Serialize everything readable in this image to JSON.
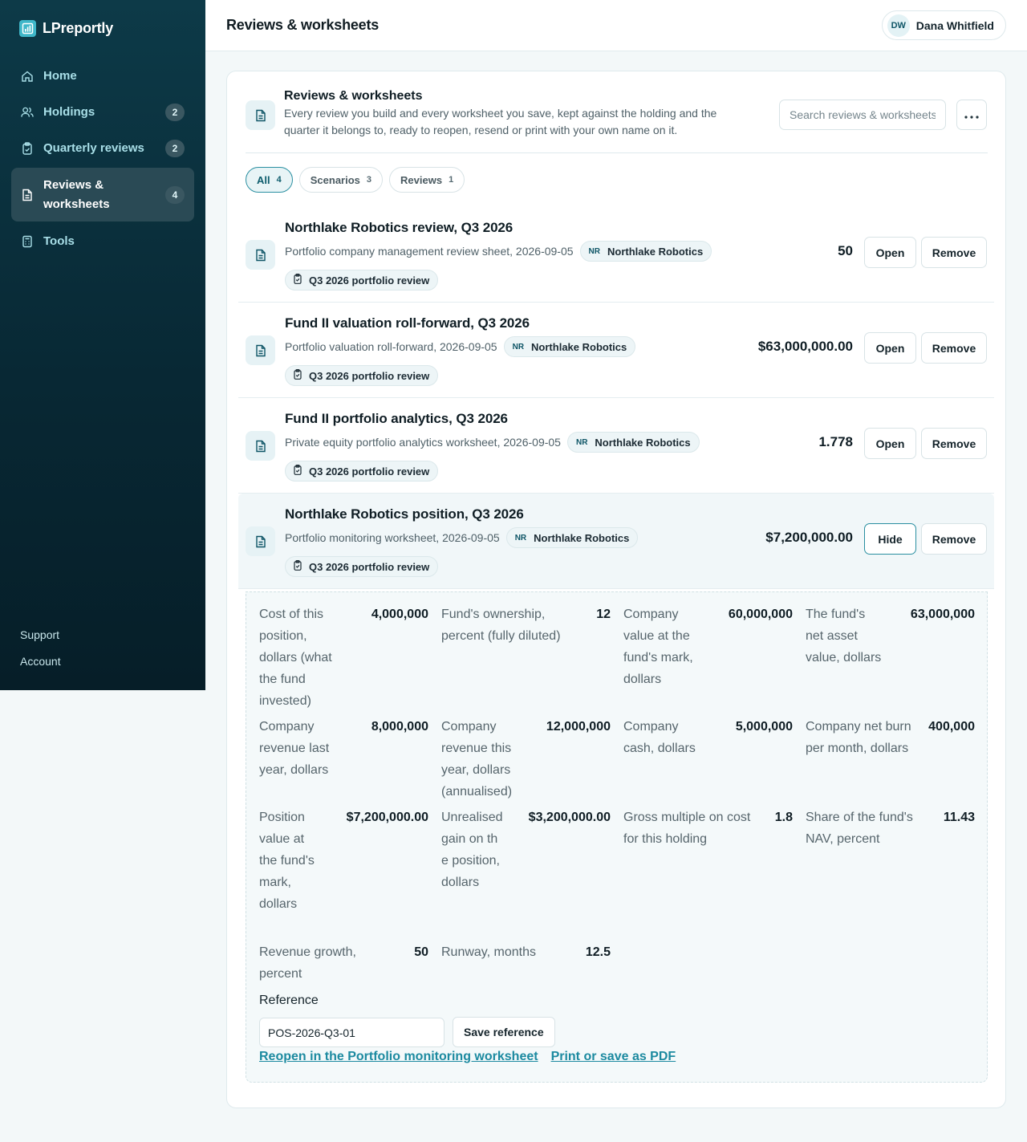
{
  "app": {
    "name": "LPreportly"
  },
  "sidebar": {
    "items": [
      {
        "label": "Home",
        "badge": "",
        "icon": "home-icon"
      },
      {
        "label": "Holdings",
        "badge": "2",
        "icon": "users-icon"
      },
      {
        "label": "Quarterly reviews",
        "badge": "2",
        "icon": "clipboard-icon"
      },
      {
        "label": "Reviews & worksheets",
        "badge": "4",
        "icon": "document-icon"
      },
      {
        "label": "Tools",
        "badge": "",
        "icon": "calculator-icon"
      }
    ],
    "footer": {
      "support": "Support",
      "account": "Account"
    }
  },
  "header": {
    "title": "Reviews & worksheets",
    "user": {
      "initials": "DW",
      "name": "Dana Whitfield"
    }
  },
  "card": {
    "title": "Reviews & worksheets",
    "description": "Every review you build and every worksheet you save, kept against the holding and the quarter it belongs to, ready to reopen, resend or print with your own name on it.",
    "search_placeholder": "Search reviews & worksheets",
    "more_label": "⋯"
  },
  "filters": [
    {
      "label": "All",
      "count": "4"
    },
    {
      "label": "Scenarios",
      "count": "3"
    },
    {
      "label": "Reviews",
      "count": "1"
    }
  ],
  "rows": [
    {
      "title": "Northlake Robotics review, Q3 2026",
      "subtitle": "Portfolio company management review sheet, 2026-09-05",
      "company_initials": "NR",
      "company": "Northlake Robotics",
      "review": "Q3 2026 portfolio review",
      "value": "50",
      "action": "Open",
      "remove": "Remove"
    },
    {
      "title": "Fund II valuation roll-forward, Q3 2026",
      "subtitle": "Portfolio valuation roll-forward, 2026-09-05",
      "company_initials": "NR",
      "company": "Northlake Robotics",
      "review": "Q3 2026 portfolio review",
      "value": "$63,000,000.00",
      "action": "Open",
      "remove": "Remove"
    },
    {
      "title": "Fund II portfolio analytics, Q3 2026",
      "subtitle": "Private equity portfolio analytics worksheet, 2026-09-05",
      "company_initials": "NR",
      "company": "Northlake Robotics",
      "review": "Q3 2026 portfolio review",
      "value": "1.778",
      "action": "Open",
      "remove": "Remove"
    },
    {
      "title": "Northlake Robotics position, Q3 2026",
      "subtitle": "Portfolio monitoring worksheet, 2026-09-05",
      "company_initials": "NR",
      "company": "Northlake Robotics",
      "review": "Q3 2026 portfolio review",
      "value": "$7,200,000.00",
      "action": "Hide",
      "remove": "Remove"
    }
  ],
  "detail": {
    "fields": [
      {
        "label": "Cost of this position, dollars (what the fund invested)",
        "value": "4,000,000"
      },
      {
        "label": "Fund's ownership, percent (fully diluted)",
        "value": "12"
      },
      {
        "label": "Company value at the fund's mark, dollars",
        "value": "60,000,000"
      },
      {
        "label": "The fund's net asset value, dollars",
        "value": "63,000,000"
      },
      {
        "label": "Company revenue last year, dollars",
        "value": "8,000,000"
      },
      {
        "label": "Company revenue this year, dollars (annualised)",
        "value": "12,000,000"
      },
      {
        "label": "Company cash, dollars",
        "value": "5,000,000"
      },
      {
        "label": "Company net burn per month, dollars",
        "value": "400,000"
      },
      {
        "label": "Position value at the fund's mark, dollars",
        "value": "$7,200,000.00"
      },
      {
        "label": "Unrealised gain on the position, dollars",
        "value": "$3,200,000.00"
      },
      {
        "label": "Gross multiple on cost for this holding",
        "value": "1.8"
      },
      {
        "label": "Share of the fund's NAV, percent",
        "value": "11.43"
      },
      {
        "label": "Revenue growth, percent",
        "value": "50"
      },
      {
        "label": "Runway, months",
        "value": "12.5"
      }
    ],
    "reference_label": "Reference",
    "reference_value": "POS-2026-Q3-01",
    "save_reference": "Save reference",
    "reopen_link": "Reopen in the Portfolio monitoring worksheet",
    "print_link": "Print or save as PDF"
  }
}
